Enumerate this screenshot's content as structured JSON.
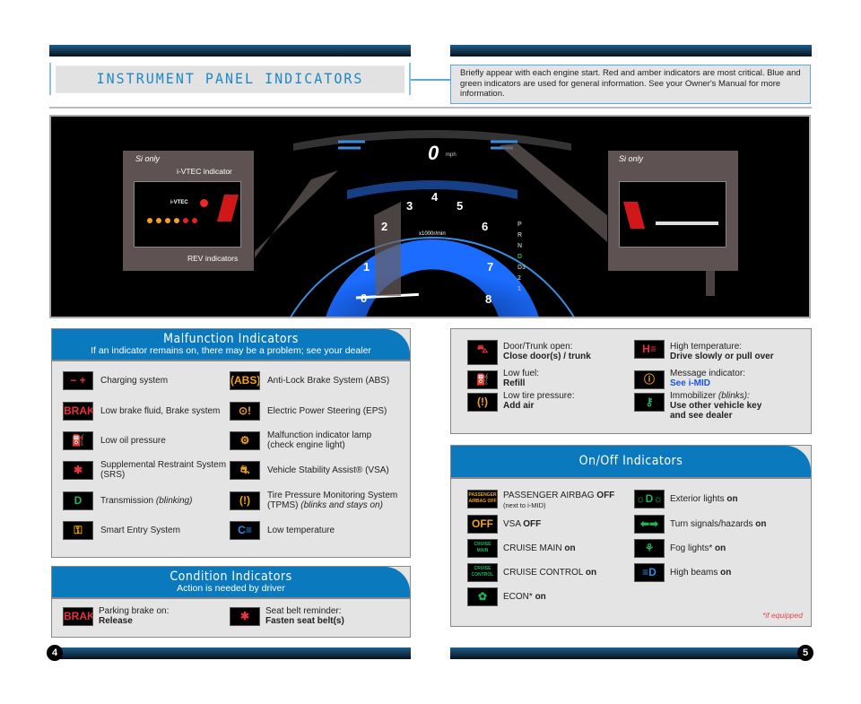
{
  "header": {
    "title": "INSTRUMENT PANEL INDICATORS",
    "note": "Briefly appear with each engine start. Red and amber indicators are most critical. Blue and green indicators are used for general information. See your Owner's Manual for more information."
  },
  "photo": {
    "left_callout": {
      "label": "Si only",
      "vtec": "i-VTEC indicator",
      "rev": "REV indicators",
      "badge": "i-VTEC"
    },
    "right_callout": {
      "label": "Si only"
    },
    "speed": "0",
    "speed_unit": "mph",
    "tach_unit": "x1000r/min",
    "tach_numbers": [
      "0",
      "1",
      "2",
      "3",
      "4",
      "5",
      "6",
      "7",
      "8"
    ],
    "gears": [
      "P",
      "R",
      "N",
      "D",
      "D3",
      "2",
      "1"
    ]
  },
  "malfunction": {
    "title": "Malfunction Indicators",
    "subtitle": "If an indicator remains on, there may be a problem; see your dealer",
    "items": [
      {
        "icon": "battery-icon",
        "glyph": "− +",
        "color": "red",
        "label": "Charging system"
      },
      {
        "icon": "abs-icon",
        "glyph": "(ABS)",
        "color": "amber",
        "label": "Anti-Lock Brake System (ABS)"
      },
      {
        "icon": "brake-icon",
        "glyph": "BRAKE",
        "color": "red",
        "label": "Low brake fluid, Brake system"
      },
      {
        "icon": "eps-icon",
        "glyph": "⊙!",
        "color": "amber",
        "label": "Electric Power Steering (EPS)"
      },
      {
        "icon": "oil-can-icon",
        "glyph": "⛽",
        "color": "red",
        "label": "Low oil pressure"
      },
      {
        "icon": "check-engine-icon",
        "glyph": "⚙",
        "color": "amber",
        "label": "Malfunction indicator lamp",
        "label2": "(check engine light)"
      },
      {
        "icon": "airbag-icon",
        "glyph": "✱",
        "color": "red",
        "label": "Supplemental Restraint System",
        "label2": "(SRS)"
      },
      {
        "icon": "vsa-icon",
        "glyph": "⛐",
        "color": "amber",
        "label": "Vehicle Stability Assist® (VSA)"
      },
      {
        "icon": "transmission-d-icon",
        "glyph": "D",
        "color": "green",
        "label": "Transmission",
        "label_em": "(blinking)"
      },
      {
        "icon": "tpms-icon",
        "glyph": "(!)",
        "color": "amber",
        "label": "Tire Pressure Monitoring System",
        "label2": "(TPMS)",
        "label2_em": "(blinks and stays on)"
      },
      {
        "icon": "smart-entry-icon",
        "glyph": "⚿",
        "color": "amber",
        "label": "Smart Entry System"
      },
      {
        "icon": "low-temperature-icon",
        "glyph": "C≡",
        "color": "blue",
        "label": "Low temperature"
      }
    ]
  },
  "condition": {
    "title": "Condition Indicators",
    "subtitle": "Action is needed by driver",
    "items": [
      {
        "icon": "parking-brake-icon",
        "glyph": "BRAKE",
        "color": "red",
        "line1": "Parking brake on:",
        "line2": "Release"
      },
      {
        "icon": "seat-belt-icon",
        "glyph": "✱",
        "color": "red",
        "line1": "Seat belt reminder:",
        "line2": "Fasten seat belt(s)"
      }
    ]
  },
  "info": {
    "items": [
      {
        "icon": "door-open-icon",
        "glyph": "⛍",
        "color": "red",
        "line1": "Door/Trunk open:",
        "line2": "Close door(s) / trunk"
      },
      {
        "icon": "high-temperature-icon",
        "glyph": "H≡",
        "color": "red",
        "line1": "High temperature:",
        "line2": "Drive slowly or pull over"
      },
      {
        "icon": "fuel-icon",
        "glyph": "⛽",
        "color": "amber",
        "line1": "Low fuel:",
        "line2": "Refill"
      },
      {
        "icon": "message-icon",
        "glyph": "ⓘ",
        "color": "amber",
        "line1": "Message indicator:",
        "line2": "See i-MID"
      },
      {
        "icon": "tire-pressure-icon",
        "glyph": "(!)",
        "color": "amber",
        "line1": "Low tire pressure:",
        "line2": "Add air"
      },
      {
        "icon": "immobilizer-icon",
        "glyph": "⚷",
        "color": "green",
        "line1": "Immobilizer",
        "line1_em": "(blinks):",
        "line2": "Use other vehicle key",
        "line3": "and see dealer"
      }
    ],
    "link_color": "#1a55e0"
  },
  "onoff": {
    "title": "On/Off Indicators",
    "footnote": "*if equipped",
    "items": [
      {
        "icon": "passenger-airbag-off-icon",
        "glyph": "PASSENGER AIRBAG OFF",
        "color": "amber",
        "label": "PASSENGER AIRBAG ",
        "bold": "OFF",
        "sub": "(next to i-MID)"
      },
      {
        "icon": "exterior-lights-icon",
        "glyph": "☼D☼",
        "color": "green",
        "label": "Exterior lights ",
        "bold": "on"
      },
      {
        "icon": "vsa-off-icon",
        "glyph": "OFF",
        "color": "amber",
        "label": "VSA ",
        "bold": "OFF"
      },
      {
        "icon": "turn-signals-icon",
        "glyph": "⬅➡",
        "color": "green",
        "label": "Turn signals/hazards ",
        "bold": "on"
      },
      {
        "icon": "cruise-main-icon",
        "glyph": "CRUISE MAIN",
        "color": "green",
        "label": "CRUISE MAIN ",
        "bold": "on"
      },
      {
        "icon": "fog-lights-icon",
        "glyph": "⚘",
        "color": "green",
        "label": "Fog lights* ",
        "bold": "on"
      },
      {
        "icon": "cruise-control-icon",
        "glyph": "CRUISE CONTROL",
        "color": "green",
        "label": "CRUISE CONTROL ",
        "bold": "on"
      },
      {
        "icon": "high-beams-icon",
        "glyph": "≡D",
        "color": "blue",
        "label": "High beams ",
        "bold": "on"
      },
      {
        "icon": "econ-icon",
        "glyph": "✿",
        "color": "green",
        "label": "ECON* ",
        "bold": "on"
      }
    ]
  },
  "pages": {
    "left": "4",
    "right": "5"
  }
}
